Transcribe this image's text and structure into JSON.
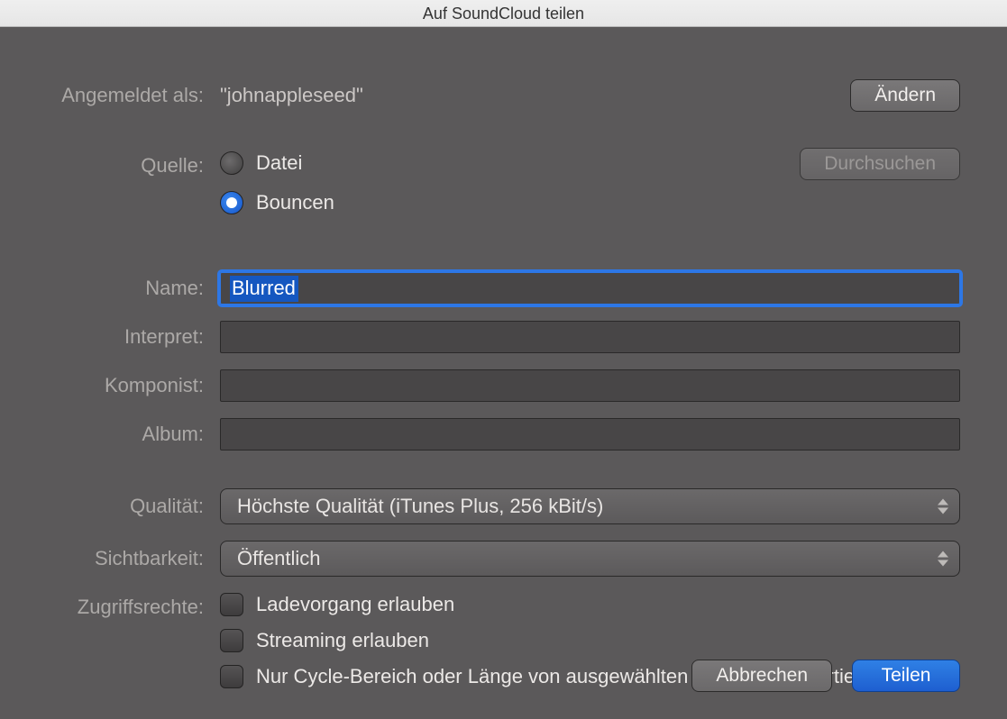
{
  "title": "Auf SoundCloud teilen",
  "account": {
    "label": "Angemeldet als:",
    "value": "\"johnappleseed\"",
    "change_btn": "Ändern"
  },
  "source": {
    "label": "Quelle:",
    "file_label": "Datei",
    "bounce_label": "Bouncen",
    "selected": "bounce",
    "browse_btn": "Durchsuchen"
  },
  "fields": {
    "name": {
      "label": "Name:",
      "value": "Blurred"
    },
    "interpret": {
      "label": "Interpret:",
      "value": ""
    },
    "composer": {
      "label": "Komponist:",
      "value": ""
    },
    "album": {
      "label": "Album:",
      "value": ""
    }
  },
  "quality": {
    "label": "Qualität:",
    "value": "Höchste Qualität (iTunes Plus, 256 kBit/s)"
  },
  "visibility": {
    "label": "Sichtbarkeit:",
    "value": "Öffentlich"
  },
  "access": {
    "label": "Zugriffsrechte:",
    "download": "Ladevorgang erlauben",
    "streaming": "Streaming erlauben",
    "cycle": "Nur Cycle-Bereich oder Länge von ausgewählten Regionen exportieren"
  },
  "footer": {
    "cancel": "Abbrechen",
    "share": "Teilen"
  }
}
